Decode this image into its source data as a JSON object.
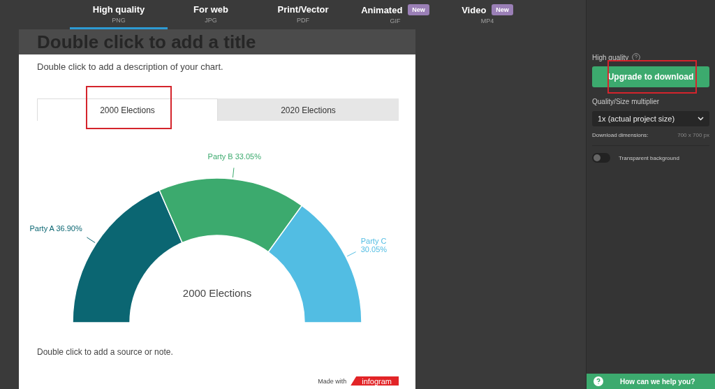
{
  "export_tabs": [
    {
      "label": "High quality",
      "format": "PNG",
      "selected": true
    },
    {
      "label": "For web",
      "format": "JPG",
      "selected": false
    },
    {
      "label": "Print/Vector",
      "format": "PDF",
      "selected": false
    },
    {
      "label": "Animated",
      "badge": "New",
      "format": "GIF",
      "selected": false
    },
    {
      "label": "Video",
      "badge": "New",
      "format": "MP4",
      "selected": false
    }
  ],
  "card": {
    "title": "Double click to add a title",
    "description": "Double click to add a description of your chart.",
    "chart_tabs": [
      {
        "label": "2000 Elections",
        "selected": true,
        "highlighted": true
      },
      {
        "label": "2020 Elections",
        "selected": false,
        "highlighted": false
      }
    ],
    "chart_data": {
      "type": "donut",
      "title": "2000 Elections",
      "categories": [
        "Party A",
        "Party B",
        "Party C"
      ],
      "values": [
        36.9,
        33.05,
        30.05
      ],
      "value_labels": [
        "36.90%",
        "33.05%",
        "30.05%"
      ],
      "colors": [
        "#0b6672",
        "#3caa6e",
        "#52bde3"
      ],
      "data_labels": true
    },
    "note": "Double click to add a source or note.",
    "made_with": "Made with",
    "brand": "infogram"
  },
  "panel": {
    "heading": "High quality",
    "button": {
      "label": "Upgrade to download",
      "highlighted": true
    },
    "multiplier_label": "Quality/Size multiplier",
    "multiplier_value": "1x (actual project size)",
    "dimensions_label": "Download dimensions:",
    "dimensions_value": "700 x 700 px",
    "transparent": {
      "label": "Transparent background",
      "on": false
    }
  },
  "help": "How can we help you?"
}
